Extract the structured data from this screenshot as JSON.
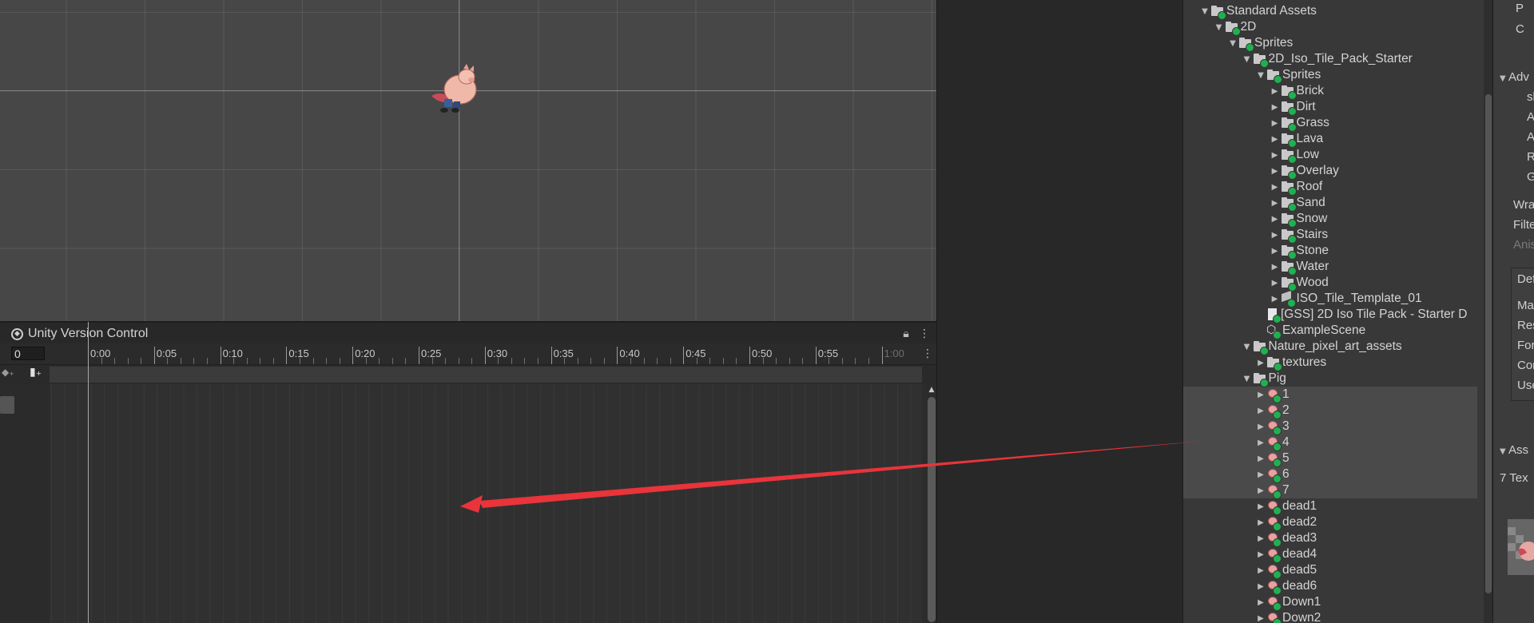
{
  "animation_panel": {
    "tab_title": "Unity Version Control",
    "frame_value": "0",
    "timeline_labels": [
      "0:00",
      "0:05",
      "0:10",
      "0:15",
      "0:20",
      "0:25",
      "0:30",
      "0:35",
      "0:40",
      "0:45",
      "0:50",
      "0:55",
      "1:00"
    ],
    "lock_icon": "lock-icon",
    "menu_icon": "kebab-menu-icon"
  },
  "project": {
    "rows": [
      {
        "depth": 0,
        "arrow": "open",
        "icon": "folder",
        "label": "Standard Assets"
      },
      {
        "depth": 1,
        "arrow": "open",
        "icon": "folder",
        "label": "2D"
      },
      {
        "depth": 2,
        "arrow": "open",
        "icon": "folder",
        "label": "Sprites"
      },
      {
        "depth": 3,
        "arrow": "open",
        "icon": "folder",
        "label": "2D_Iso_Tile_Pack_Starter"
      },
      {
        "depth": 4,
        "arrow": "open",
        "icon": "folder",
        "label": "Sprites"
      },
      {
        "depth": 5,
        "arrow": "closed",
        "icon": "folder",
        "label": "Brick"
      },
      {
        "depth": 5,
        "arrow": "closed",
        "icon": "folder",
        "label": "Dirt"
      },
      {
        "depth": 5,
        "arrow": "closed",
        "icon": "folder",
        "label": "Grass"
      },
      {
        "depth": 5,
        "arrow": "closed",
        "icon": "folder",
        "label": "Lava"
      },
      {
        "depth": 5,
        "arrow": "closed",
        "icon": "folder",
        "label": "Low"
      },
      {
        "depth": 5,
        "arrow": "closed",
        "icon": "folder",
        "label": "Overlay"
      },
      {
        "depth": 5,
        "arrow": "closed",
        "icon": "folder",
        "label": "Roof"
      },
      {
        "depth": 5,
        "arrow": "closed",
        "icon": "folder",
        "label": "Sand"
      },
      {
        "depth": 5,
        "arrow": "closed",
        "icon": "folder",
        "label": "Snow"
      },
      {
        "depth": 5,
        "arrow": "closed",
        "icon": "folder",
        "label": "Stairs"
      },
      {
        "depth": 5,
        "arrow": "closed",
        "icon": "folder",
        "label": "Stone"
      },
      {
        "depth": 5,
        "arrow": "closed",
        "icon": "folder",
        "label": "Water"
      },
      {
        "depth": 5,
        "arrow": "closed",
        "icon": "folder",
        "label": "Wood"
      },
      {
        "depth": 5,
        "arrow": "closed",
        "icon": "tile",
        "label": "ISO_Tile_Template_01"
      },
      {
        "depth": 4,
        "arrow": "none",
        "icon": "file",
        "label": "[GSS] 2D Iso Tile Pack - Starter D"
      },
      {
        "depth": 4,
        "arrow": "none",
        "icon": "unity",
        "label": "ExampleScene"
      },
      {
        "depth": 3,
        "arrow": "open",
        "icon": "folder",
        "label": "Nature_pixel_art_assets"
      },
      {
        "depth": 4,
        "arrow": "closed",
        "icon": "folder",
        "label": "textures"
      },
      {
        "depth": 3,
        "arrow": "open",
        "icon": "folder",
        "label": "Pig"
      },
      {
        "depth": 4,
        "arrow": "closed",
        "icon": "pig",
        "label": "1"
      },
      {
        "depth": 4,
        "arrow": "closed",
        "icon": "pig",
        "label": "2"
      },
      {
        "depth": 4,
        "arrow": "closed",
        "icon": "pig",
        "label": "3"
      },
      {
        "depth": 4,
        "arrow": "closed",
        "icon": "pig",
        "label": "4"
      },
      {
        "depth": 4,
        "arrow": "closed",
        "icon": "pig",
        "label": "5"
      },
      {
        "depth": 4,
        "arrow": "closed",
        "icon": "pig",
        "label": "6"
      },
      {
        "depth": 4,
        "arrow": "closed",
        "icon": "pig",
        "label": "7"
      },
      {
        "depth": 4,
        "arrow": "closed",
        "icon": "pig",
        "label": "dead1"
      },
      {
        "depth": 4,
        "arrow": "closed",
        "icon": "pig",
        "label": "dead2"
      },
      {
        "depth": 4,
        "arrow": "closed",
        "icon": "pig",
        "label": "dead3"
      },
      {
        "depth": 4,
        "arrow": "closed",
        "icon": "pig",
        "label": "dead4"
      },
      {
        "depth": 4,
        "arrow": "closed",
        "icon": "pig",
        "label": "dead5"
      },
      {
        "depth": 4,
        "arrow": "closed",
        "icon": "pig",
        "label": "dead6"
      },
      {
        "depth": 4,
        "arrow": "closed",
        "icon": "pig",
        "label": "Down1"
      },
      {
        "depth": 4,
        "arrow": "closed",
        "icon": "pig",
        "label": "Down2"
      }
    ]
  },
  "inspector": {
    "items": [
      "P",
      "C",
      "Adv",
      "sl",
      "A",
      "A",
      "R",
      "G",
      "Wra",
      "Filte",
      "Anis",
      "Def",
      "Ma",
      "Res",
      "For",
      "Cor",
      "Use",
      "Ass",
      "7 Tex"
    ]
  },
  "colors": {
    "accent_green": "#1fb14f",
    "annotation_arrow": "#e8343a"
  }
}
